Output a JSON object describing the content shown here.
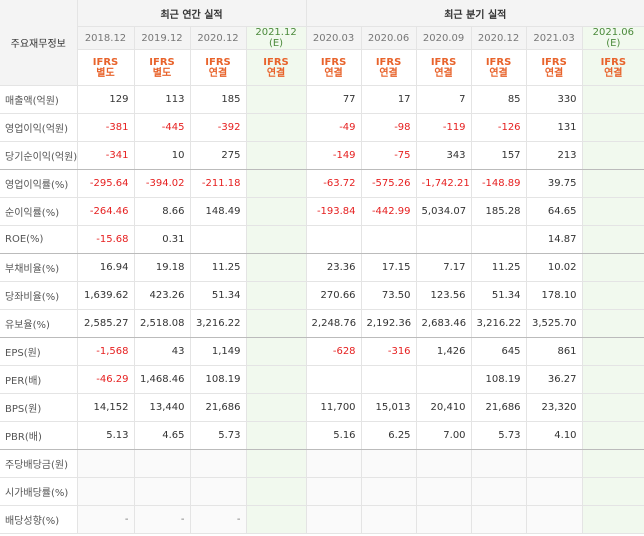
{
  "header": {
    "row_label": "주요재무정보",
    "annual_title": "최근 연간 실적",
    "quarterly_title": "최근 분기 실적",
    "annual_periods": [
      "2018.12",
      "2019.12",
      "2020.12",
      "2021.12\n(E)"
    ],
    "quarterly_periods": [
      "2020.03",
      "2020.06",
      "2020.09",
      "2020.12",
      "2021.03",
      "2021.06\n(E)"
    ],
    "annual_standards": [
      "IFRS\n별도",
      "IFRS\n별도",
      "IFRS\n연결",
      "IFRS\n연결"
    ],
    "quarterly_standards": [
      "IFRS\n연결",
      "IFRS\n연결",
      "IFRS\n연결",
      "IFRS\n연결",
      "IFRS\n연결",
      "IFRS\n연결"
    ]
  },
  "rows": [
    {
      "label": "매출액(억원)",
      "annual": [
        "129",
        "113",
        "185",
        ""
      ],
      "quarterly": [
        "77",
        "17",
        "7",
        "85",
        "330",
        ""
      ]
    },
    {
      "label": "영업이익(억원)",
      "annual": [
        "-381",
        "-445",
        "-392",
        ""
      ],
      "quarterly": [
        "-49",
        "-98",
        "-119",
        "-126",
        "131",
        ""
      ]
    },
    {
      "label": "당기순이익(억원)",
      "annual": [
        "-341",
        "10",
        "275",
        ""
      ],
      "quarterly": [
        "-149",
        "-75",
        "343",
        "157",
        "213",
        ""
      ]
    },
    {
      "label": "영업이익률(%)",
      "annual": [
        "-295.64",
        "-394.02",
        "-211.18",
        ""
      ],
      "quarterly": [
        "-63.72",
        "-575.26",
        "-1,742.21",
        "-148.89",
        "39.75",
        ""
      ]
    },
    {
      "label": "순이익률(%)",
      "annual": [
        "-264.46",
        "8.66",
        "148.49",
        ""
      ],
      "quarterly": [
        "-193.84",
        "-442.99",
        "5,034.07",
        "185.28",
        "64.65",
        ""
      ]
    },
    {
      "label": "ROE(%)",
      "annual": [
        "-15.68",
        "0.31",
        "",
        ""
      ],
      "quarterly": [
        "",
        "",
        "",
        "",
        "14.87",
        ""
      ]
    },
    {
      "label": "부채비율(%)",
      "annual": [
        "16.94",
        "19.18",
        "11.25",
        ""
      ],
      "quarterly": [
        "23.36",
        "17.15",
        "7.17",
        "11.25",
        "10.02",
        ""
      ]
    },
    {
      "label": "당좌비율(%)",
      "annual": [
        "1,639.62",
        "423.26",
        "51.34",
        ""
      ],
      "quarterly": [
        "270.66",
        "73.50",
        "123.56",
        "51.34",
        "178.10",
        ""
      ]
    },
    {
      "label": "유보율(%)",
      "annual": [
        "2,585.27",
        "2,518.08",
        "3,216.22",
        ""
      ],
      "quarterly": [
        "2,248.76",
        "2,192.36",
        "2,683.46",
        "3,216.22",
        "3,525.70",
        ""
      ]
    },
    {
      "label": "EPS(원)",
      "annual": [
        "-1,568",
        "43",
        "1,149",
        ""
      ],
      "quarterly": [
        "-628",
        "-316",
        "1,426",
        "645",
        "861",
        ""
      ]
    },
    {
      "label": "PER(배)",
      "annual": [
        "-46.29",
        "1,468.46",
        "108.19",
        ""
      ],
      "quarterly": [
        "",
        "",
        "",
        "108.19",
        "36.27",
        ""
      ]
    },
    {
      "label": "BPS(원)",
      "annual": [
        "14,152",
        "13,440",
        "21,686",
        ""
      ],
      "quarterly": [
        "11,700",
        "15,013",
        "20,410",
        "21,686",
        "23,320",
        ""
      ]
    },
    {
      "label": "PBR(배)",
      "annual": [
        "5.13",
        "4.65",
        "5.73",
        ""
      ],
      "quarterly": [
        "5.16",
        "6.25",
        "7.00",
        "5.73",
        "4.10",
        ""
      ]
    },
    {
      "label": "주당배당금(원)",
      "annual": [
        "",
        "",
        "",
        ""
      ],
      "quarterly": [
        "",
        "",
        "",
        "",
        "",
        ""
      ]
    },
    {
      "label": "시가배당률(%)",
      "annual": [
        "",
        "",
        "",
        ""
      ],
      "quarterly": [
        "",
        "",
        "",
        "",
        "",
        ""
      ]
    },
    {
      "label": "배당성향(%)",
      "annual": [
        "-",
        "-",
        "-",
        ""
      ],
      "quarterly": [
        "",
        "",
        "",
        "",
        "",
        ""
      ]
    }
  ],
  "colors": {
    "negative": "#e62020",
    "standard": "#e8632b",
    "estimate_bg": "#f1f9ee",
    "estimate_text": "#4b8a3b"
  }
}
